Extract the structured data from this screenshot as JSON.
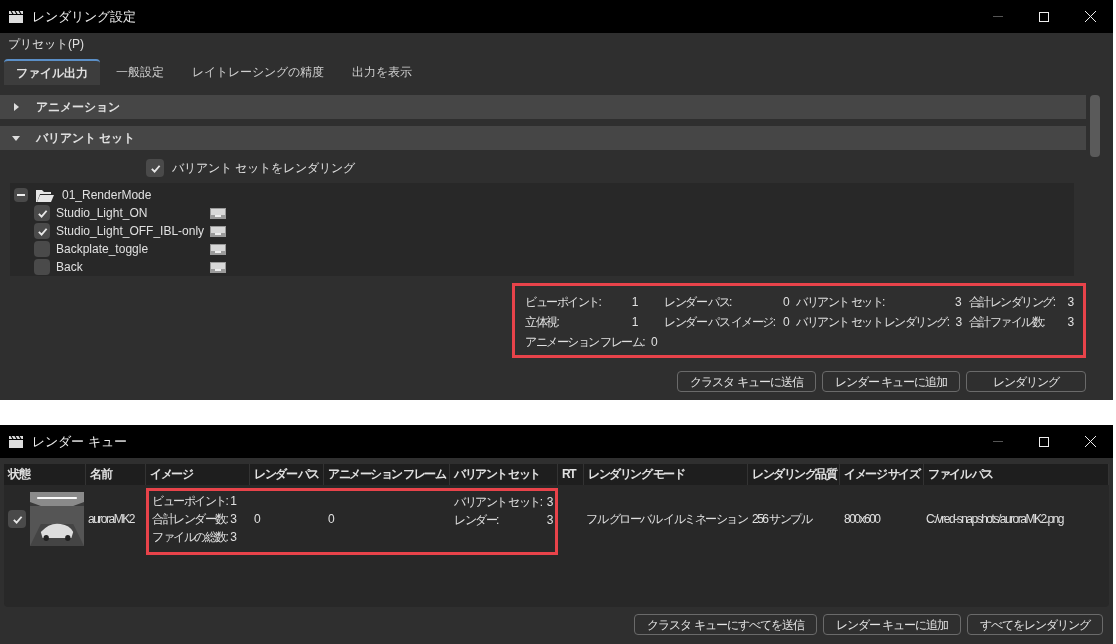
{
  "settings_window": {
    "title": "レンダリング設定",
    "menu": [
      "プリセット(P)"
    ],
    "tabs": [
      {
        "label": "ファイル出力",
        "selected": true
      },
      {
        "label": "一般設定",
        "selected": false
      },
      {
        "label": "レイトレーシングの精度",
        "selected": false
      },
      {
        "label": "出力を表示",
        "selected": false
      }
    ],
    "sections": [
      {
        "title": "アニメーション",
        "expanded": false
      },
      {
        "title": "バリアント セット",
        "expanded": true
      }
    ],
    "render_variant_sets": {
      "label": "バリアント セットをレンダリング",
      "checked": true
    },
    "tree": {
      "label": "01_RenderMode",
      "expanded": true,
      "children": [
        {
          "label": "Studio_Light_ON",
          "checked": true
        },
        {
          "label": "Studio_Light_OFF_IBL-only",
          "checked": true
        },
        {
          "label": "Backplate_toggle",
          "checked": false
        },
        {
          "label": "Back",
          "checked": false
        }
      ]
    },
    "summary_columns": [
      [
        {
          "label": "ビューポイント:",
          "value": "1"
        },
        {
          "label": "立体視:",
          "value": "1"
        },
        {
          "label": "アニメーション フレーム:",
          "value": "0"
        }
      ],
      [
        {
          "label": "レンダー パス:",
          "value": "0"
        },
        {
          "label": "レンダー パス イメージ:",
          "value": "0"
        }
      ],
      [
        {
          "label": "バリアント セット:",
          "value": "3"
        },
        {
          "label": "バリアント セット レンダリング:",
          "value": "3"
        }
      ],
      [
        {
          "label": "合計レンダリング:",
          "value": "3"
        },
        {
          "label": "合計ファイル数:",
          "value": "3"
        }
      ]
    ],
    "buttons": [
      "クラスタ キューに送信",
      "レンダー キューに追加",
      "レンダリング"
    ]
  },
  "queue_window": {
    "title": "レンダー キュー",
    "columns": [
      "状態",
      "名前",
      "イメージ",
      "レンダー パス",
      "アニメーション フレーム",
      "バリアント セット",
      "RT",
      "レンダリング モード",
      "レンダリング品質",
      "イメージ サイズ",
      "ファイル パス"
    ],
    "rows": [
      {
        "checked": true,
        "name": "auroraMK2",
        "image": [
          {
            "label": "ビューポイント:",
            "value": "1"
          },
          {
            "label": "合計レンダー数:",
            "value": "3"
          },
          {
            "label": "ファイルの総数:",
            "value": "3"
          }
        ],
        "render_pass": "0",
        "animation_frame": "0",
        "variant_set": [
          {
            "label": "バリアント セット:",
            "value": "3"
          },
          {
            "label": "レンダー:",
            "value": "3"
          }
        ],
        "mode": "フル グローバル イルミネーション",
        "quality": "256 サンプル",
        "size": "800x600",
        "path": "C:/vred-snapshots/auroraMK2.png"
      }
    ],
    "buttons": [
      "クラスタ キューにすべてを送信",
      "レンダー キューに追加",
      "すべてをレンダリング"
    ]
  }
}
